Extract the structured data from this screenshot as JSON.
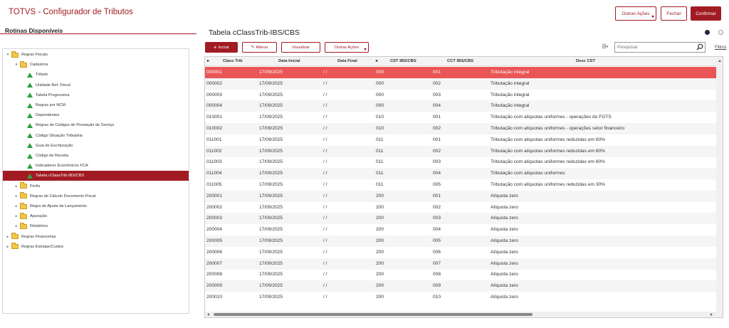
{
  "app": {
    "title": "TOTVS - Configurador de Tributos",
    "outras_acoes": "Outras Ações",
    "fechar": "Fechar",
    "confirmar": "Confirmar"
  },
  "left": {
    "title": "Rotinas Disponíveis",
    "tree": [
      {
        "label": "Regras Fiscais",
        "type": "folder",
        "level": 0,
        "expanded": true
      },
      {
        "label": "Cadastros",
        "type": "folder",
        "level": 1,
        "expanded": true
      },
      {
        "label": "Tributo",
        "type": "leaf",
        "level": 2
      },
      {
        "label": "Unidade Ref. Fiscal",
        "type": "leaf",
        "level": 2
      },
      {
        "label": "Tabela Progressiva",
        "type": "leaf",
        "level": 2
      },
      {
        "label": "Regras por NCM",
        "type": "leaf",
        "level": 2
      },
      {
        "label": "Dependentes",
        "type": "leaf",
        "level": 2
      },
      {
        "label": "Regras de Códigos de Prestação de Serviço",
        "type": "leaf",
        "level": 2
      },
      {
        "label": "Código Situação Tributária",
        "type": "leaf",
        "level": 2
      },
      {
        "label": "Guia de Escrituração",
        "type": "leaf",
        "level": 2
      },
      {
        "label": "Código de Receita",
        "type": "leaf",
        "level": 2
      },
      {
        "label": "Indicadores Econômicos FCA",
        "type": "leaf",
        "level": 2
      },
      {
        "label": "Tabela cClassTrib-IBS/CBS",
        "type": "leaf",
        "level": 2,
        "selected": true
      },
      {
        "label": "Perfis",
        "type": "folder",
        "level": 1,
        "expanded": false
      },
      {
        "label": "Regras de Cálculo Documento Fiscal",
        "type": "folder",
        "level": 1,
        "expanded": false
      },
      {
        "label": "Regra de Ajuste de Lançamento",
        "type": "folder",
        "level": 1,
        "expanded": false
      },
      {
        "label": "Apuração",
        "type": "folder",
        "level": 1,
        "expanded": false
      },
      {
        "label": "Relatórios",
        "type": "folder",
        "level": 1,
        "expanded": false
      },
      {
        "label": "Regras Financeiras",
        "type": "folder",
        "level": 0,
        "expanded": false
      },
      {
        "label": "Regras Estoque/Custos",
        "type": "folder",
        "level": 0,
        "expanded": false
      }
    ]
  },
  "main": {
    "title": "Tabela cClassTrib-IBS/CBS",
    "incluir": "Incluir",
    "alterar": "Alterar",
    "visualizar": "Visualizar",
    "outras_acoes": "Outras Ações",
    "search_placeholder": "Pesquisar",
    "filtros": "Filtros",
    "columns": [
      "Class Trib",
      "Data Inicial",
      "Data Final",
      "CST IBS/CBS",
      "CCT IBS/CBS",
      "Desc CST"
    ],
    "rows": [
      [
        "000001",
        "17/09/2025",
        "/ /",
        "000",
        "001",
        "Tributação integral"
      ],
      [
        "000002",
        "17/09/2025",
        "/ /",
        "000",
        "002",
        "Tributação integral"
      ],
      [
        "000003",
        "17/09/2025",
        "/ /",
        "000",
        "003",
        "Tributação integral"
      ],
      [
        "000004",
        "17/09/2025",
        "/ /",
        "000",
        "004",
        "Tributação integral"
      ],
      [
        "010001",
        "17/09/2025",
        "/ /",
        "010",
        "001",
        "Tributação com alíquotas uniformes - operações do FGTS"
      ],
      [
        "010002",
        "17/09/2025",
        "/ /",
        "010",
        "002",
        "Tributação com alíquotas uniformes - operações setor financeiro"
      ],
      [
        "011001",
        "17/09/2025",
        "/ /",
        "011",
        "001",
        "Tributação com alíquotas uniformes reduzidas em 60%"
      ],
      [
        "011002",
        "17/09/2025",
        "/ /",
        "011",
        "002",
        "Tributação com alíquotas uniformes reduzidas em 60%"
      ],
      [
        "011003",
        "17/09/2025",
        "/ /",
        "011",
        "003",
        "Tributação com alíquotas uniformes reduzidas em 60%"
      ],
      [
        "011004",
        "17/09/2025",
        "/ /",
        "011",
        "004",
        "Tributação com alíquotas uniformes"
      ],
      [
        "011005",
        "17/09/2025",
        "/ /",
        "011",
        "005",
        "Tributação com alíquotas uniformes reduzidas em 30%"
      ],
      [
        "200001",
        "17/09/2025",
        "/ /",
        "200",
        "001",
        "Alíquota zero"
      ],
      [
        "200002",
        "17/09/2025",
        "/ /",
        "200",
        "002",
        "Alíquota zero"
      ],
      [
        "200003",
        "17/09/2025",
        "/ /",
        "200",
        "003",
        "Alíquota zero"
      ],
      [
        "200004",
        "17/09/2025",
        "/ /",
        "200",
        "004",
        "Alíquota zero"
      ],
      [
        "200005",
        "17/09/2025",
        "/ /",
        "200",
        "005",
        "Alíquota zero"
      ],
      [
        "200006",
        "17/09/2025",
        "/ /",
        "200",
        "006",
        "Alíquota zero"
      ],
      [
        "200007",
        "17/09/2025",
        "/ /",
        "200",
        "007",
        "Alíquota zero"
      ],
      [
        "200008",
        "17/09/2025",
        "/ /",
        "200",
        "008",
        "Alíquota zero"
      ],
      [
        "200009",
        "17/09/2025",
        "/ /",
        "200",
        "009",
        "Alíquota zero"
      ],
      [
        "200010",
        "17/09/2025",
        "/ /",
        "200",
        "010",
        "Alíquota zero"
      ]
    ],
    "selected_row": 0
  },
  "colors": {
    "brand": "#a11b23",
    "selected_row": "#ea5555"
  }
}
